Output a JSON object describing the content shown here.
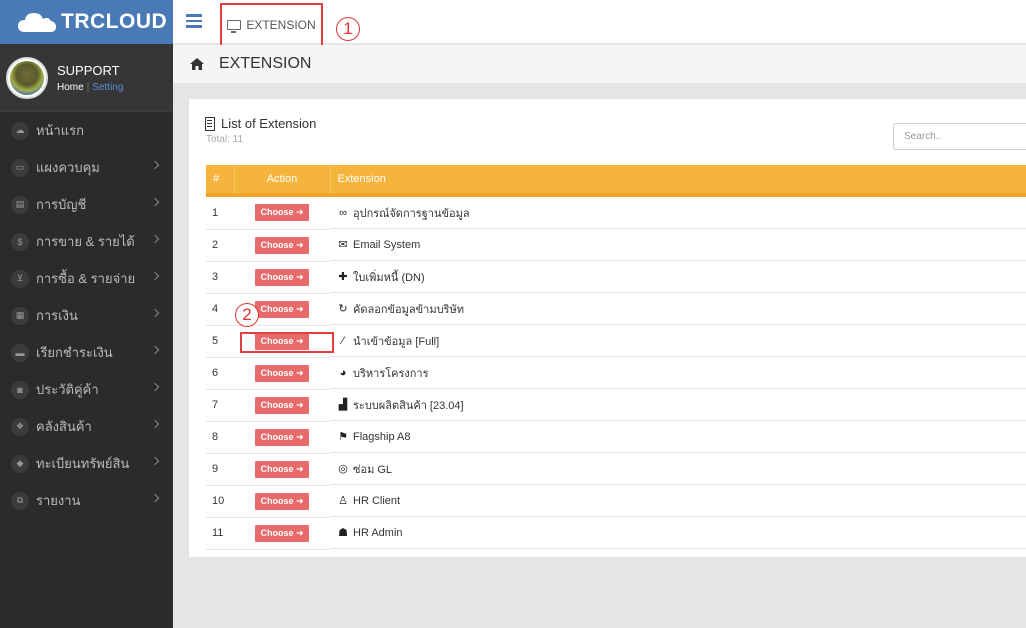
{
  "brand": {
    "name": "TRCLOUD"
  },
  "profile": {
    "name": "SUPPORT",
    "home_link": "Home",
    "separator": "|",
    "setting_link": "Setting"
  },
  "sidebar": {
    "items": [
      {
        "label": "หน้าแรก",
        "icon": "cloud-icon"
      },
      {
        "label": "แผงควบคุม",
        "icon": "monitor-icon"
      },
      {
        "label": "การบัญชี",
        "icon": "book-icon"
      },
      {
        "label": "การขาย & รายได้",
        "icon": "dollar-icon"
      },
      {
        "label": "การซื้อ & รายจ่าย",
        "icon": "cart-icon"
      },
      {
        "label": "การเงิน",
        "icon": "calendar-icon"
      },
      {
        "label": "เรียกชำระเงิน",
        "icon": "card-icon"
      },
      {
        "label": "ประวัติคู่ค้า",
        "icon": "contact-icon"
      },
      {
        "label": "คลังสินค้า",
        "icon": "cubes-icon"
      },
      {
        "label": "ทะเบียนทรัพย์สิน",
        "icon": "diamond-icon"
      },
      {
        "label": "รายงาน",
        "icon": "copy-icon"
      }
    ]
  },
  "topbar": {
    "tab_label": "EXTENSION",
    "annotation_1": "1",
    "annotation_2": "2"
  },
  "page": {
    "title": "EXTENSION"
  },
  "panel": {
    "title": "List of Extension",
    "total": "Total: 11",
    "search_placeholder": "Search.."
  },
  "table": {
    "headers": [
      "#",
      "Action",
      "Extension"
    ],
    "choose_label": "Choose ➔",
    "rows": [
      {
        "num": "1",
        "icon": "gamepad-icon",
        "glyph": "∞",
        "name": "อุปกรณ์จัดการฐานข้อมูล"
      },
      {
        "num": "2",
        "icon": "envelope-icon",
        "glyph": "✉",
        "name": "Email System"
      },
      {
        "num": "3",
        "icon": "plus-icon",
        "glyph": "✚",
        "name": "ใบเพิ่มหนี้ (DN)"
      },
      {
        "num": "4",
        "icon": "refresh-icon",
        "glyph": "↻",
        "name": "คัดลอกข้อมูลข้ามบริษัท"
      },
      {
        "num": "5",
        "icon": "magic-wand-icon",
        "glyph": "⁄",
        "name": "นำเข้าข้อมูล [Full]"
      },
      {
        "num": "6",
        "icon": "pie-chart-icon",
        "glyph": "◕",
        "name": "บริหารโครงการ"
      },
      {
        "num": "7",
        "icon": "industry-icon",
        "glyph": "▟",
        "name": "ระบบผลิตสินค้า [23.04]"
      },
      {
        "num": "8",
        "icon": "flag-icon",
        "glyph": "⚑",
        "name": "Flagship A8"
      },
      {
        "num": "9",
        "icon": "life-ring-icon",
        "glyph": "◎",
        "name": "ซ่อม GL"
      },
      {
        "num": "10",
        "icon": "user-icon",
        "glyph": "♙",
        "name": "HR Client"
      },
      {
        "num": "11",
        "icon": "users-icon",
        "glyph": "☗",
        "name": "HR Admin"
      }
    ]
  },
  "colors": {
    "brand": "#4a7ab6",
    "table_header": "#f5b43c",
    "choose_button": "#e86b6b",
    "highlight": "#e24040"
  }
}
